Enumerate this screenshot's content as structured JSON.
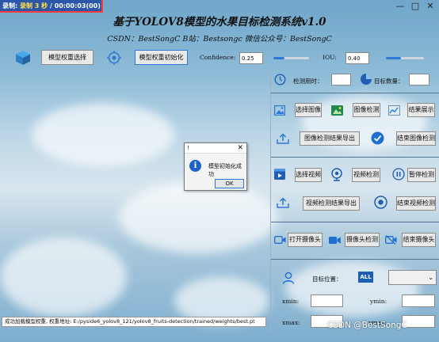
{
  "recording": {
    "label": "录制:",
    "status": "录制 3 秒",
    "sep": "/",
    "time": "00:00:03(00)"
  },
  "window": {
    "minimize": "—",
    "maximize": "□",
    "close": "✕"
  },
  "header": {
    "title": "基于YOLOV8模型的水果目标检测系统v1.0",
    "subtitle": "CSDN：BestSongC   B站：Bestsongc   微信公众号：BestSongC"
  },
  "toolbar": {
    "select_weights_label": "模型权重选择",
    "init_model_label": "模型权重初始化",
    "confidence_label": "Confidence:",
    "confidence_value": "0.25",
    "confidence_level": 0.3,
    "iou_label": "IOU:",
    "iou_value": "0.40",
    "iou_level": 0.4
  },
  "stats": {
    "time_label": "检测用时：",
    "time_value": "",
    "count_label": "目标数量：",
    "count_value": ""
  },
  "image_section": {
    "select_label": "选择图像",
    "detect_label": "图像检测",
    "result_label": "结果展示",
    "export_label": "图像检测结果导出",
    "end_label": "结束图像检测"
  },
  "video_section": {
    "select_label": "选择视频",
    "detect_label": "视频检测",
    "pause_label": "暂停检测",
    "export_label": "视频检测结果导出",
    "end_label": "结束视频检测"
  },
  "camera_section": {
    "open_label": "打开摄像头",
    "detect_label": "摄像头检测",
    "end_label": "结束摄像头"
  },
  "target": {
    "position_label": "目标位置：",
    "all_badge": "ALL",
    "select_value": "",
    "xmin_label": "xmin:",
    "ymin_label": "ymin:",
    "xmax_label": "xmax:",
    "ymax_label": "ymax:"
  },
  "status_bar": {
    "text": "成功加载模型权重, 权重地址: E:/pyside6_yolov8_121/yolov8_fruits-detection/trained/weights/best.pt"
  },
  "dialog": {
    "title": "!",
    "message": "模型初始化成功",
    "ok_label": "OK"
  },
  "watermark": "CSDN @BestSongC",
  "colors": {
    "accent": "#2e78d6",
    "recording_bg": "#2c57a8",
    "recording_border": "#ff3b3b"
  }
}
